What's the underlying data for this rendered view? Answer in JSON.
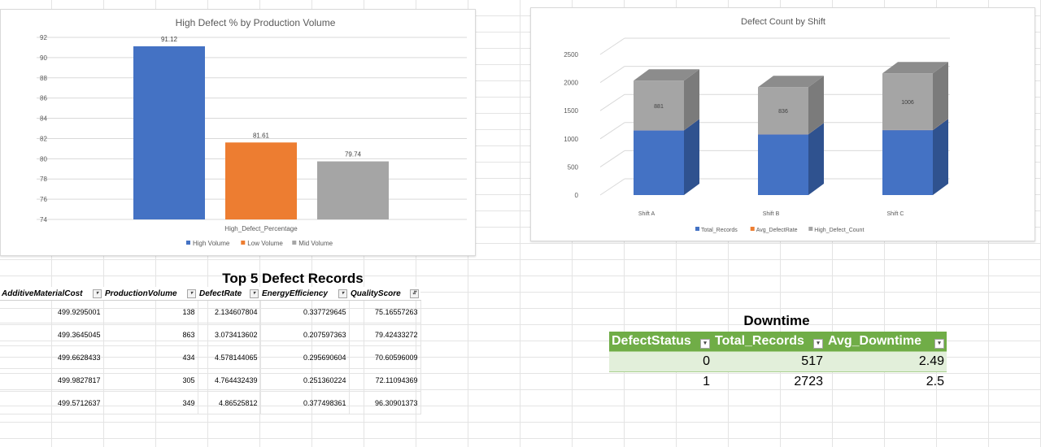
{
  "chart_data": [
    {
      "type": "bar",
      "title": "High Defect % by Production Volume",
      "xlabel": "High_Defect_Percentage",
      "categories": [
        "High_Defect_Percentage"
      ],
      "series": [
        {
          "name": "High Volume",
          "values": [
            91.12
          ],
          "color": "#4472c4"
        },
        {
          "name": "Low Volume",
          "values": [
            81.61
          ],
          "color": "#ed7d31"
        },
        {
          "name": "Mid Volume",
          "values": [
            79.74
          ],
          "color": "#a5a5a5"
        }
      ],
      "ylim": [
        74,
        92
      ],
      "yticks": [
        "92",
        "90",
        "88",
        "86",
        "84",
        "82",
        "80",
        "78",
        "76",
        "74"
      ],
      "legend": "bottom",
      "grid": true
    },
    {
      "type": "bar",
      "stacked": true,
      "three_d": true,
      "title": "Defect Count by Shift",
      "categories": [
        "Shift A",
        "Shift B",
        "Shift C"
      ],
      "series": [
        {
          "name": "Total_Records",
          "values": [
            1150,
            1080,
            1155
          ],
          "color": "#4472c4"
        },
        {
          "name": "Avg_DefectRate",
          "values": [
            2.5,
            2.5,
            2.5
          ],
          "color": "#ed7d31"
        },
        {
          "name": "High_Defect_Count",
          "values": [
            881,
            836,
            1006
          ],
          "labels": [
            "881",
            "836",
            "1006"
          ],
          "color": "#a5a5a5"
        }
      ],
      "ylim": [
        0,
        2500
      ],
      "yticks": [
        "0",
        "500",
        "1000",
        "1500",
        "2000",
        "2500"
      ],
      "legend": "bottom",
      "grid": true
    }
  ],
  "top5": {
    "title": "Top 5 Defect Records",
    "headers": [
      "AdditiveMaterialCost",
      "ProductionVolume",
      "DefectRate",
      "EnergyEfficiency",
      "QualityScore"
    ],
    "rows": [
      [
        "499.9295001",
        "138",
        "2.134607804",
        "0.337729645",
        "75.16557263"
      ],
      [
        "499.3645045",
        "863",
        "3.073413602",
        "0.207597363",
        "79.42433272"
      ],
      [
        "499.6628433",
        "434",
        "4.578144065",
        "0.295690604",
        "70.60596009"
      ],
      [
        "499.9827817",
        "305",
        "4.764432439",
        "0.251360224",
        "72.11094369"
      ],
      [
        "499.5712637",
        "349",
        "4.86525812",
        "0.377498361",
        "96.30901373"
      ]
    ]
  },
  "downtime": {
    "title": "Downtime",
    "headers": [
      "DefectStatus",
      "Total_Records",
      "Avg_Downtime"
    ],
    "rows": [
      [
        "0",
        "517",
        "2.49"
      ],
      [
        "1",
        "2723",
        "2.5"
      ]
    ]
  },
  "colors": {
    "accent_green": "#70ad47",
    "band_green": "#e2efda"
  }
}
